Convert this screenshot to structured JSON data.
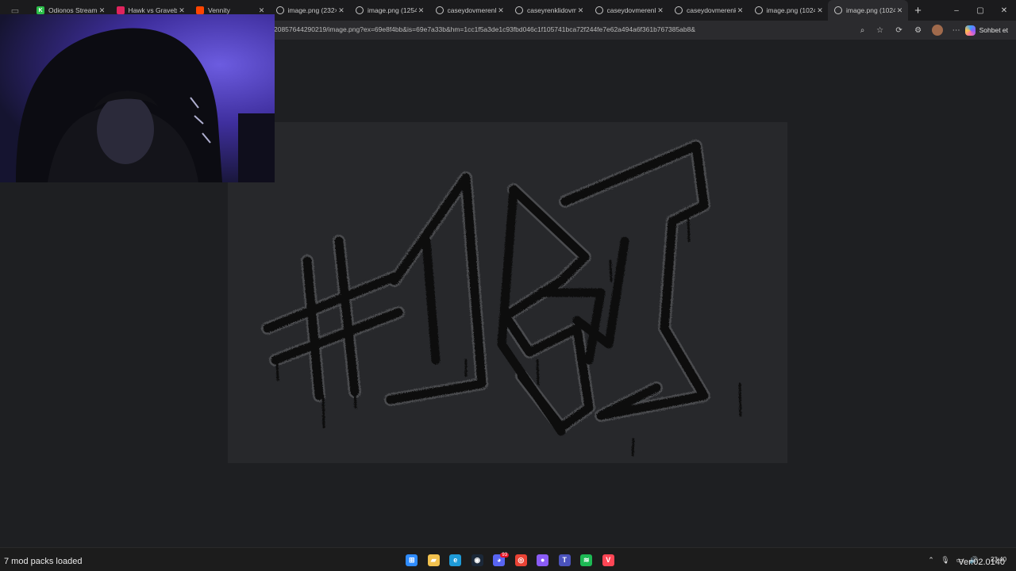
{
  "browser": {
    "tabs": [
      {
        "title": "",
        "icon": "tab-strip-icon"
      },
      {
        "title": "Odionos Stream - E",
        "icon": "k-icon",
        "color": "#2bbf4a"
      },
      {
        "title": "Hawk vs Graveborn",
        "icon": "red-icon",
        "color": "#e0245e"
      },
      {
        "title": "Vennity",
        "icon": "reddit-icon",
        "color": "#ff4500"
      },
      {
        "title": "image.png (232×6",
        "icon": "globe-icon"
      },
      {
        "title": "image.png (1254×1",
        "icon": "globe-icon"
      },
      {
        "title": "caseydovmerenkl",
        "icon": "globe-icon"
      },
      {
        "title": "caseyrenklidovme",
        "icon": "globe-icon"
      },
      {
        "title": "caseydovmerenkli",
        "icon": "globe-icon"
      },
      {
        "title": "caseydovmerenkli",
        "icon": "globe-icon"
      },
      {
        "title": "image.png (1024×4",
        "icon": "globe-icon"
      },
      {
        "title": "image.png (1024×",
        "icon": "globe-icon",
        "active": true
      }
    ],
    "new_tab": "+",
    "window_controls": {
      "minimize": "–",
      "maximize": "▢",
      "close": "✕"
    },
    "url": "20857644290219/image.png?ex=69e8f4bb&is=69e7a33b&hm=1cc1f5a3de1c93fbd046c1f105741bca72f244fe7e62a494a6f361b767385ab8&",
    "copilot_label": "Sohbet et"
  },
  "viewer": {
    "artwork_text": "#1ST"
  },
  "taskbar": {
    "status_text": "7 mod packs loaded",
    "apps": [
      {
        "icon": "windows-start-icon",
        "color": "#2f8cff"
      },
      {
        "icon": "folder-icon",
        "color": "#f2c14e"
      },
      {
        "icon": "edge-icon",
        "color": "#1f9bd8"
      },
      {
        "icon": "steam-icon",
        "color": "#1b2838"
      },
      {
        "icon": "discord-icon",
        "color": "#5865f2",
        "badge": "93"
      },
      {
        "icon": "chrome-icon",
        "color": "#ea4335"
      },
      {
        "icon": "obs-icon",
        "color": "#8b5cf6"
      },
      {
        "icon": "teams-icon",
        "color": "#4b53bc"
      },
      {
        "icon": "spotify-icon",
        "color": "#1db954"
      },
      {
        "icon": "valorant-icon",
        "color": "#ff4655"
      }
    ],
    "time": "23:40",
    "overlay_text": "Ver.02.0140"
  },
  "colors": {
    "viewer_bg": "#1e1f22",
    "image_bg": "#27282b",
    "paint": "#0d0e0f"
  }
}
